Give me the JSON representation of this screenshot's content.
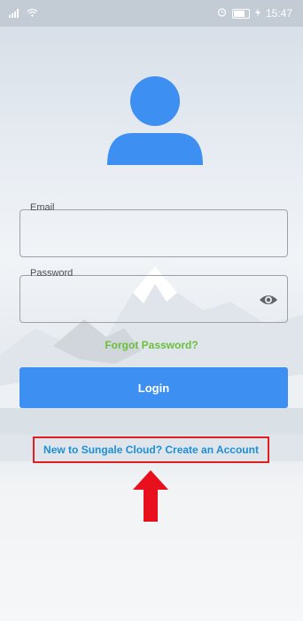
{
  "status_bar": {
    "signal_icon": "signal-icon",
    "wifi_icon": "wifi-icon",
    "alarm_icon": "alarm-icon",
    "battery_icon": "battery-icon",
    "battery_level": 80,
    "time": "15:47"
  },
  "avatar": {
    "icon": "user-icon",
    "color": "#3d8ff2"
  },
  "email": {
    "label": "Email",
    "value": "",
    "placeholder": ""
  },
  "password": {
    "label": "Password",
    "value": "",
    "placeholder": "",
    "toggle_icon": "eye-icon"
  },
  "forgot_password": "Forgot Password?",
  "login_button": "Login",
  "create_account": "New to Sungale Cloud? Create an Account",
  "annotation": {
    "highlight_color": "#e02020",
    "arrow_icon": "up-arrow-icon"
  }
}
